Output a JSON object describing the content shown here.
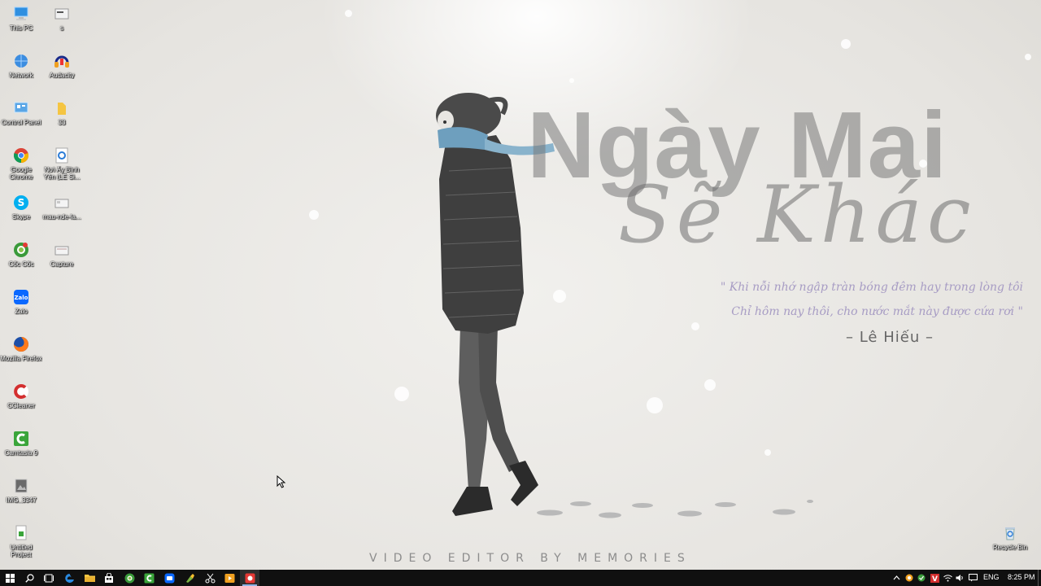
{
  "wallpaper": {
    "title_line1": "Ngày Mai",
    "title_line2": "Sẽ Khác",
    "lyric_line1": "\" Khi nỗi nhớ ngập tràn bóng đêm hay trong lòng tôi",
    "lyric_line2": "Chỉ hôm nay thôi, cho nước mắt này được cứa rơi \"",
    "artist": "– Lê Hiếu –",
    "credit": "VIDEO EDITOR BY MEMORIES"
  },
  "desktop_icons": [
    {
      "label": "This PC",
      "icon": "computer-icon"
    },
    {
      "label": "s",
      "icon": "file-icon"
    },
    {
      "label": "Network",
      "icon": "network-icon"
    },
    {
      "label": "Audacity",
      "icon": "audacity-icon"
    },
    {
      "label": "Control Panel",
      "icon": "control-panel-icon"
    },
    {
      "label": "33",
      "icon": "folder-icon"
    },
    {
      "label": "Google Chrome",
      "icon": "chrome-icon"
    },
    {
      "label": "Nơi Ấy Bình Yên (LẺ Si...",
      "icon": "media-file-icon"
    },
    {
      "label": "Skype",
      "icon": "skype-icon"
    },
    {
      "label": "mau-nde-la...",
      "icon": "image-file-icon"
    },
    {
      "label": "Cốc Cốc",
      "icon": "coccoc-icon"
    },
    {
      "label": "Capture",
      "icon": "image-file-icon"
    },
    {
      "label": "Zalo",
      "icon": "zalo-icon"
    },
    {
      "label": "Mozilla Firefox",
      "icon": "firefox-icon"
    },
    {
      "label": "CCleaner",
      "icon": "ccleaner-icon"
    },
    {
      "label": "Camtasia 9",
      "icon": "camtasia-icon"
    },
    {
      "label": "IMG_3347",
      "icon": "photo-file-icon"
    },
    {
      "label": "Untitled Project",
      "icon": "project-file-icon"
    },
    {
      "label": "Recycle Bin",
      "icon": "recycle-bin-icon"
    }
  ],
  "taskbar": {
    "language": "ENG",
    "time": "8:25 PM"
  },
  "colors": {
    "taskbar_bg": "#101010",
    "lyric": "#a79cc4",
    "active_indicator": "#8fb3e6"
  }
}
